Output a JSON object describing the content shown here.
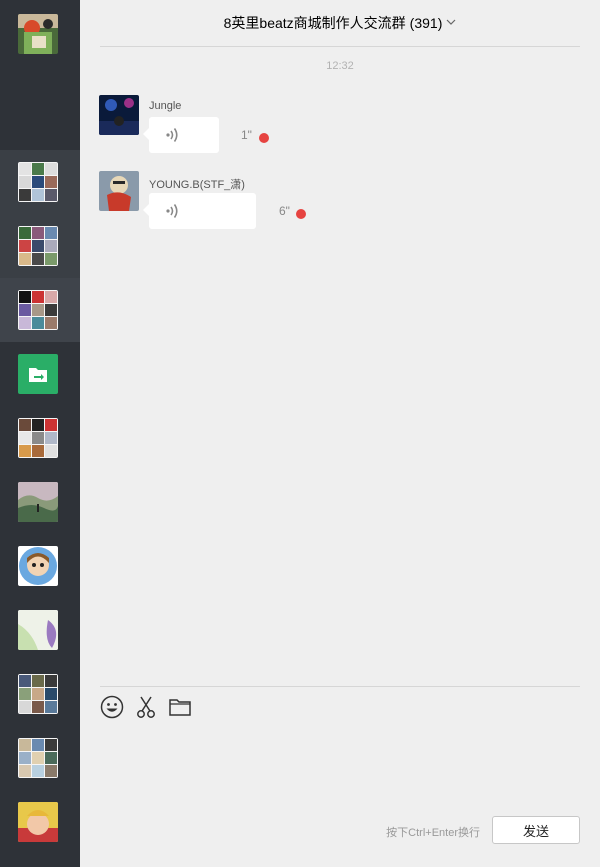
{
  "chat": {
    "title": "8英里beatz商城制作人交流群",
    "member_count": "(391)",
    "timestamp": "12:32"
  },
  "messages": [
    {
      "sender": "Jungle",
      "duration": "1\"",
      "unread": true
    },
    {
      "sender": "YOUNG.B(STF_潇)",
      "duration": "6\"",
      "unread": true
    }
  ],
  "input": {
    "hint": "按下Ctrl+Enter换行",
    "send_label": "发送"
  },
  "icons": {
    "emoji": "emoji-icon",
    "screenshot": "scissors-icon",
    "file": "folder-icon",
    "voice": "voice-wave-icon"
  },
  "colors": {
    "sidebar": "#2e3238",
    "unread_dot": "#e64340",
    "file_helper": "#2aae67"
  }
}
